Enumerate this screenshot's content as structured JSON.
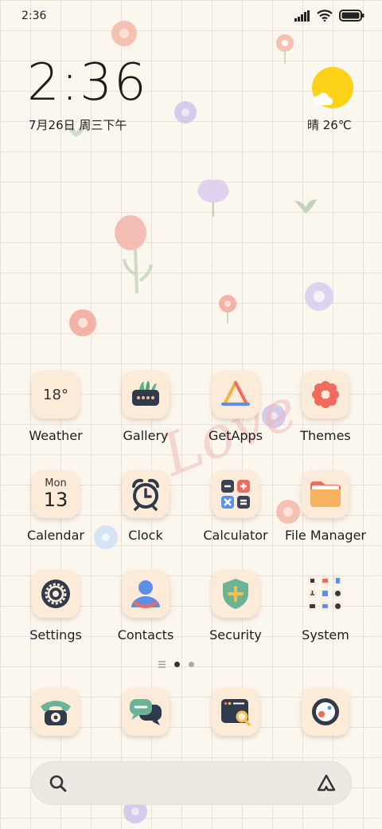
{
  "status_bar": {
    "time": "2:36",
    "icons": [
      "signal-icon",
      "wifi-icon",
      "battery-icon"
    ]
  },
  "clock_widget": {
    "time": "2:36",
    "date": "7月26日 周三下午"
  },
  "weather_widget": {
    "condition_temp": "晴 26℃",
    "icon": "sun-cloud-icon"
  },
  "wallpaper": {
    "watermark": "Love"
  },
  "apps": [
    {
      "label": "Weather",
      "icon_text": "18°",
      "icon": "weather-icon"
    },
    {
      "label": "Gallery",
      "icon": "gallery-icon"
    },
    {
      "label": "GetApps",
      "icon": "getapps-icon"
    },
    {
      "label": "Themes",
      "icon": "themes-icon"
    },
    {
      "label": "Calendar",
      "icon_day": "Mon",
      "icon_date": "13",
      "icon": "calendar-icon"
    },
    {
      "label": "Clock",
      "icon": "alarm-clock-icon"
    },
    {
      "label": "Calculator",
      "icon": "calculator-icon"
    },
    {
      "label": "File Manager",
      "icon": "folder-icon"
    },
    {
      "label": "Settings",
      "icon": "gear-icon"
    },
    {
      "label": "Contacts",
      "icon": "contacts-icon"
    },
    {
      "label": "Security",
      "icon": "shield-icon"
    },
    {
      "label": "System",
      "icon": "system-folder-icon"
    }
  ],
  "page_indicator": {
    "pages": 2,
    "current": 1
  },
  "dock": [
    {
      "name": "phone",
      "icon": "phone-icon"
    },
    {
      "name": "messages",
      "icon": "messages-icon"
    },
    {
      "name": "browser",
      "icon": "browser-icon"
    },
    {
      "name": "camera",
      "icon": "camera-icon"
    }
  ],
  "search_bar": {
    "left_icon": "search-icon",
    "right_icon": "assistant-icon"
  },
  "colors": {
    "background": "#fbf7ee",
    "tile": "#fdebd9",
    "sun": "#ffd21a",
    "accent_red": "#f06b5e"
  }
}
